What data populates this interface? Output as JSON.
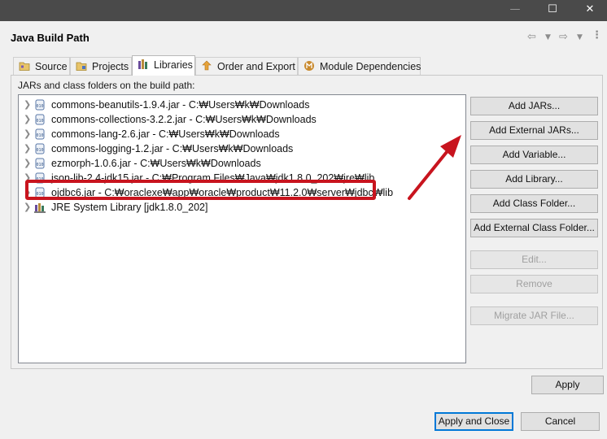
{
  "window": {
    "min_glyph": "—",
    "max_glyph": "☐",
    "close_glyph": "✕"
  },
  "header": {
    "title": "Java Build Path"
  },
  "tabs": [
    {
      "label": "Source",
      "icon": "source-folder-icon",
      "active": false
    },
    {
      "label": "Projects",
      "icon": "projects-icon",
      "active": false
    },
    {
      "label": "Libraries",
      "icon": "libraries-icon",
      "active": true
    },
    {
      "label": "Order and Export",
      "icon": "order-export-icon",
      "active": false
    },
    {
      "label": "Module Dependencies",
      "icon": "module-icon",
      "active": false
    }
  ],
  "libraries": {
    "section_label": "JARs and class folders on the build path:",
    "entries": [
      {
        "label": "commons-beanutils-1.9.4.jar - C:₩Users₩k₩Downloads",
        "icon": "jar-icon"
      },
      {
        "label": "commons-collections-3.2.2.jar - C:₩Users₩k₩Downloads",
        "icon": "jar-icon"
      },
      {
        "label": "commons-lang-2.6.jar - C:₩Users₩k₩Downloads",
        "icon": "jar-icon"
      },
      {
        "label": "commons-logging-1.2.jar - C:₩Users₩k₩Downloads",
        "icon": "jar-icon"
      },
      {
        "label": "ezmorph-1.0.6.jar - C:₩Users₩k₩Downloads",
        "icon": "jar-icon"
      },
      {
        "label": "json-lib-2.4-jdk15.jar - C:₩Program Files₩Java₩jdk1.8.0_202₩jre₩lib",
        "icon": "jar-icon"
      },
      {
        "label": "ojdbc6.jar - C:₩oraclexe₩app₩oracle₩product₩11.2.0₩server₩jdbc₩lib",
        "icon": "jar-icon",
        "highlighted": true
      },
      {
        "label": "JRE System Library [jdk1.8.0_202]",
        "icon": "jre-library-icon"
      }
    ]
  },
  "buttons": {
    "add_jars": "Add JARs...",
    "add_external_jars": "Add External JARs...",
    "add_variable": "Add Variable...",
    "add_library": "Add Library...",
    "add_class_folder": "Add Class Folder...",
    "add_external_class_folder": "Add External Class Folder...",
    "edit": "Edit...",
    "remove": "Remove",
    "migrate_jar": "Migrate JAR File...",
    "apply": "Apply",
    "apply_and_close": "Apply and Close",
    "cancel": "Cancel"
  },
  "colors": {
    "highlight": "#c8141e",
    "primary_border": "#0078d7"
  }
}
